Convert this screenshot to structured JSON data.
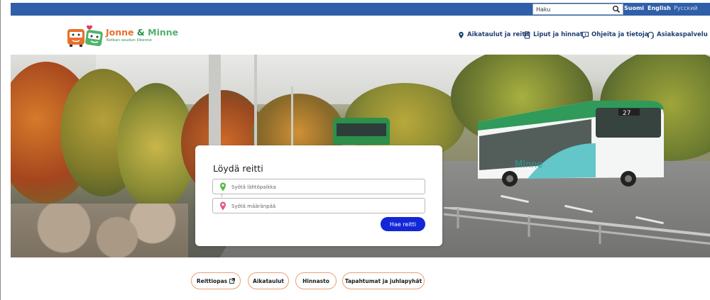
{
  "topbar": {
    "search_placeholder": "Haku",
    "languages": [
      {
        "label": "Suomi",
        "active": false
      },
      {
        "label": "English",
        "active": false
      },
      {
        "label": "Русский",
        "active": true
      }
    ],
    "bar_color": "#2f5fa8"
  },
  "logo": {
    "title_part1": "Jonne",
    "title_amp": " & ",
    "title_part2": "Minne",
    "subtitle": "Kotkan seudun liikenne"
  },
  "nav": {
    "items": [
      {
        "label": "Aikataulut ja reitit",
        "icon": "location-pin-icon"
      },
      {
        "label": "Liput ja hinnat",
        "icon": "ticket-icon"
      },
      {
        "label": "Ohjeita ja tietoja",
        "icon": "info-chat-icon"
      },
      {
        "label": "Asiakaspalvelu",
        "icon": "headset-icon"
      }
    ]
  },
  "route_card": {
    "title": "Löydä reitti",
    "from_placeholder": "Syötä lähtöpaikka",
    "to_placeholder": "Syötä määränpää",
    "submit_label": "Hae reitti",
    "button_color": "#1227d8"
  },
  "bus": {
    "route_number": "27",
    "brand_text": "Minne"
  },
  "quick_links": [
    {
      "label": "Reittiopas",
      "external": true
    },
    {
      "label": "Aikataulut",
      "external": false
    },
    {
      "label": "Hinnasto",
      "external": false
    },
    {
      "label": "Tapahtumat ja juhlapyhät",
      "external": false
    }
  ]
}
